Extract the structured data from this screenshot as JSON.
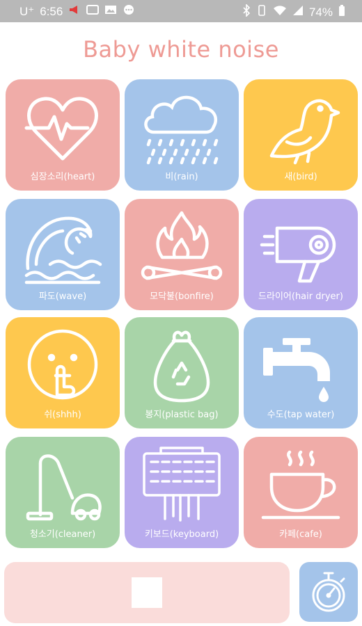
{
  "status_bar": {
    "carrier": "U⁺",
    "time": "6:56",
    "battery": "74%"
  },
  "app": {
    "title": "Baby white noise"
  },
  "sounds": [
    {
      "label": "심장소리(heart)",
      "icon": "heart-rate-icon",
      "color": "#f0aca8"
    },
    {
      "label": "비(rain)",
      "icon": "rain-cloud-icon",
      "color": "#a4c4ea"
    },
    {
      "label": "새(bird)",
      "icon": "bird-icon",
      "color": "#fec84e"
    },
    {
      "label": "파도(wave)",
      "icon": "wave-icon",
      "color": "#a4c4ea"
    },
    {
      "label": "모닥불(bonfire)",
      "icon": "bonfire-icon",
      "color": "#f0aca8"
    },
    {
      "label": "드라이어(hair dryer)",
      "icon": "hair-dryer-icon",
      "color": "#b9acee"
    },
    {
      "label": "쉬(shhh)",
      "icon": "shush-face-icon",
      "color": "#fec84e"
    },
    {
      "label": "봉지(plastic bag)",
      "icon": "plastic-bag-icon",
      "color": "#a8d4a8"
    },
    {
      "label": "수도(tap water)",
      "icon": "faucet-icon",
      "color": "#a4c4ea"
    },
    {
      "label": "청소기(cleaner)",
      "icon": "vacuum-cleaner-icon",
      "color": "#a8d4a8"
    },
    {
      "label": "키보드(keyboard)",
      "icon": "keyboard-icon",
      "color": "#b9acee"
    },
    {
      "label": "카페(cafe)",
      "icon": "coffee-cup-icon",
      "color": "#f0aca8"
    }
  ],
  "controls": {
    "stop_icon": "stop-icon",
    "timer_icon": "stopwatch-icon",
    "player_bg": "#fadcda",
    "timer_bg": "#a4c4ea"
  }
}
